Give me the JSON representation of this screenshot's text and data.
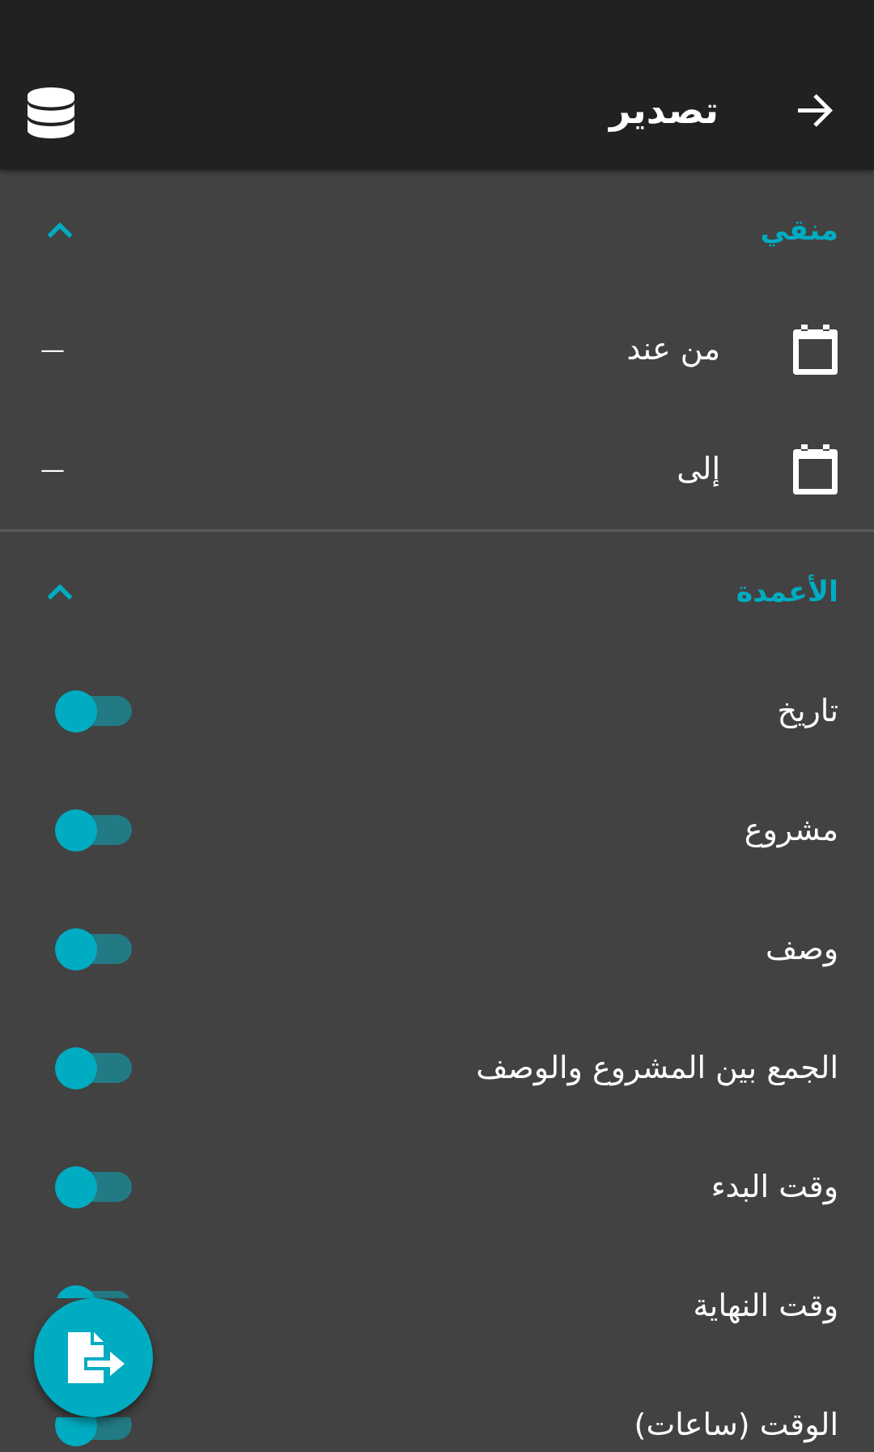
{
  "app_bar": {
    "title": "تصدير"
  },
  "sections": [
    {
      "title": "منقي",
      "kind": "dates",
      "expanded": true,
      "rows": [
        {
          "label": "من عند",
          "value": "—"
        },
        {
          "label": "إلى",
          "value": "—"
        }
      ]
    },
    {
      "title": "الأعمدة",
      "kind": "switches",
      "expanded": true,
      "rows": [
        {
          "label": "تاريخ",
          "checked": true
        },
        {
          "label": "مشروع",
          "checked": true
        },
        {
          "label": "وصف",
          "checked": true
        },
        {
          "label": "الجمع بين المشروع والوصف",
          "checked": true
        },
        {
          "label": "وقت البدء",
          "checked": true
        },
        {
          "label": "وقت النهاية",
          "checked": true
        },
        {
          "label": "الوقت (ساعات)",
          "checked": true
        }
      ]
    }
  ]
}
